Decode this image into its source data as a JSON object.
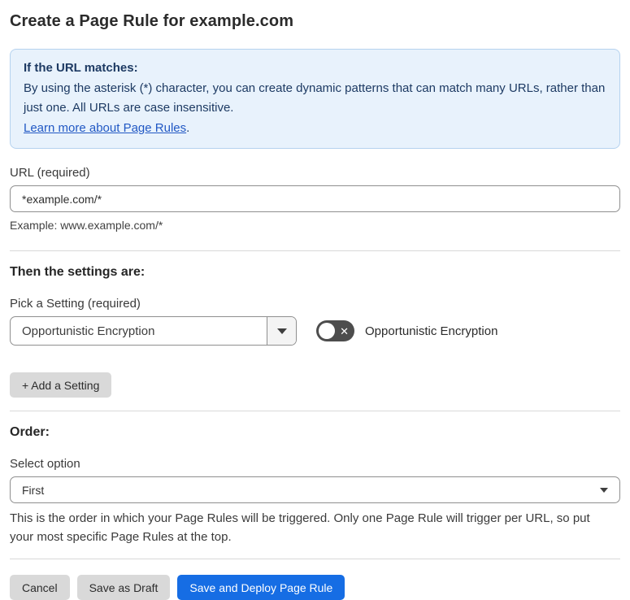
{
  "page": {
    "title": "Create a Page Rule for example.com"
  },
  "info_box": {
    "heading": "If the URL matches:",
    "body": "By using the asterisk (*) character, you can create dynamic patterns that can match many URLs, rather than just one. All URLs are case insensitive.",
    "link_label": "Learn more about Page Rules",
    "link_suffix": "."
  },
  "url_field": {
    "label": "URL (required)",
    "value": "*example.com/*",
    "helper": "Example: www.example.com/*"
  },
  "settings_section": {
    "heading": "Then the settings are:",
    "picker_label": "Pick a Setting (required)",
    "picker_value": "Opportunistic Encryption",
    "toggle_label": "Opportunistic Encryption",
    "toggle_state": "off",
    "toggle_off_glyph": "✕",
    "add_setting_label": "+ Add a Setting"
  },
  "order_section": {
    "heading": "Order:",
    "select_label": "Select option",
    "select_value": "First",
    "helper": "This is the order in which your Page Rules will be triggered. Only one Page Rule will trigger per URL, so put your most specific Page Rules at the top."
  },
  "footer": {
    "cancel_label": "Cancel",
    "save_draft_label": "Save as Draft",
    "save_deploy_label": "Save and Deploy Page Rule"
  },
  "colors": {
    "accent_blue": "#166de4",
    "info_bg": "#e8f2fc",
    "info_border": "#b5d2ef",
    "info_text": "#1d3a63",
    "link_blue": "#2158c4",
    "toggle_off_bg": "#4d4d4d",
    "button_gray": "#d9d9d9"
  }
}
